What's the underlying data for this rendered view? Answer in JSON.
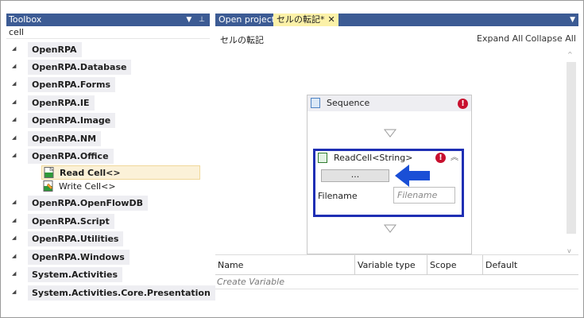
{
  "toolbox": {
    "title": "Toolbox",
    "controls": "▼ ⊥",
    "search_value": "cell",
    "categories": [
      "OpenRPA",
      "OpenRPA.Database",
      "OpenRPA.Forms",
      "OpenRPA.IE",
      "OpenRPA.Image",
      "OpenRPA.NM",
      "OpenRPA.Office",
      "OpenRPA.OpenFlowDB",
      "OpenRPA.Script",
      "OpenRPA.Utilities",
      "OpenRPA.Windows",
      "System.Activities",
      "System.Activities.Core.Presentation"
    ],
    "office_tools": [
      "Read Cell<>",
      "Write Cell<>"
    ]
  },
  "tabs": {
    "items": [
      "Open project",
      "セルの転記*"
    ],
    "close": "✕",
    "dropdown": "▼"
  },
  "designer": {
    "breadcrumb": "セルの転記",
    "expand_all": "Expand All",
    "collapse_all": "Collapse All",
    "sequence_title": "Sequence",
    "error_mark": "!",
    "activity_title": "ReadCell<String>",
    "activity_button": "...",
    "filename_label": "Filename",
    "filename_placeholder": "Filename"
  },
  "variables": {
    "columns": [
      "Name",
      "Variable type",
      "Scope",
      "Default"
    ],
    "create_text": "Create Variable"
  },
  "colors": {
    "panel_title": "#3c5b94",
    "active_tab": "#fbf1a8",
    "selection_border": "#1f2fb4",
    "arrow": "#1a4fd6",
    "error": "#c8102e"
  }
}
